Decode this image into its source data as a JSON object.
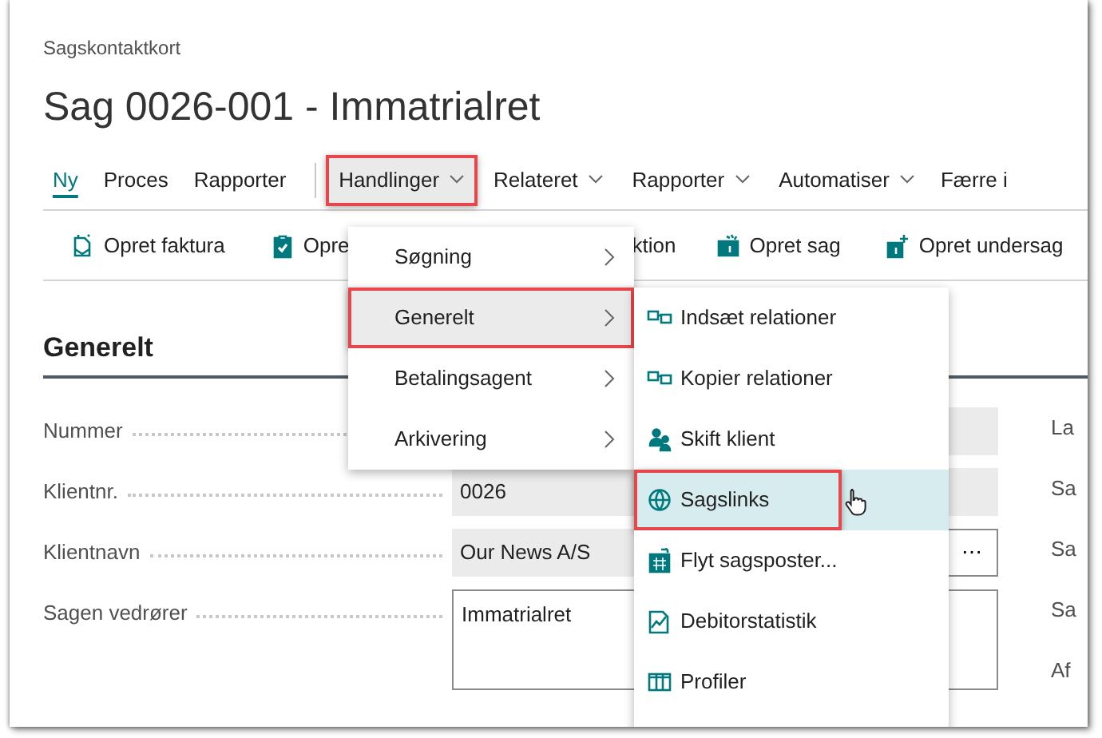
{
  "window": {
    "caption": "Sagskontaktkort",
    "title": "Sag 0026-001 - Immatrialret"
  },
  "nav": [
    {
      "kind": "link",
      "label": "Ny",
      "selected": true
    },
    {
      "kind": "link",
      "label": "Proces",
      "selected": false
    },
    {
      "kind": "link",
      "label": "Rapporter",
      "selected": false
    },
    {
      "kind": "divider"
    },
    {
      "kind": "menu",
      "label": "Handlinger",
      "expanded": true,
      "highlighted": true
    },
    {
      "kind": "menu",
      "label": "Relateret",
      "expanded": false,
      "highlighted": false
    },
    {
      "kind": "menu",
      "label": "Rapporter",
      "expanded": false,
      "highlighted": false
    },
    {
      "kind": "menu",
      "label": "Automatiser",
      "expanded": false,
      "highlighted": false
    },
    {
      "kind": "link",
      "label": "Færre i",
      "selected": false
    }
  ],
  "actions": [
    {
      "kind": "button",
      "label": "Opret faktura"
    },
    {
      "kind": "button",
      "label": "Opre"
    },
    {
      "kind": "fragment",
      "label": "ktion"
    },
    {
      "kind": "button",
      "label": "Opret sag"
    },
    {
      "kind": "button",
      "label": "Opret undersag"
    }
  ],
  "section": {
    "title": "Generelt"
  },
  "fields": [
    {
      "kind": "text",
      "label": "Nummer"
    },
    {
      "kind": "text",
      "label": "Klientnr.",
      "value": "0026"
    },
    {
      "kind": "lookup",
      "label": "Klientnavn",
      "value": "Our News A/S",
      "button": "⋯"
    },
    {
      "kind": "multiline",
      "label": "Sagen vedrører",
      "value": "Immatrialret"
    }
  ],
  "right_labels": [
    "La",
    "Sa",
    "Sa",
    "Sa",
    "Af"
  ],
  "menu": {
    "items": [
      {
        "label": "Søgning",
        "selected": false,
        "highlighted": false
      },
      {
        "label": "Generelt",
        "selected": true,
        "highlighted": true
      },
      {
        "label": "Betalingsagent",
        "selected": false,
        "highlighted": false
      },
      {
        "label": "Arkivering",
        "selected": false,
        "highlighted": false
      }
    ]
  },
  "submenu": {
    "items": [
      {
        "label": "Indsæt relationer",
        "selected": false,
        "highlighted": false
      },
      {
        "label": "Kopier relationer",
        "selected": false,
        "highlighted": false
      },
      {
        "label": "Skift klient",
        "selected": false,
        "highlighted": false
      },
      {
        "label": "Sagslinks",
        "selected": true,
        "highlighted": true
      },
      {
        "label": "Flyt sagsposter...",
        "selected": false,
        "highlighted": false
      },
      {
        "label": "Debitorstatistik",
        "selected": false,
        "highlighted": false
      },
      {
        "label": "Profiler",
        "selected": false,
        "highlighted": false
      }
    ]
  }
}
